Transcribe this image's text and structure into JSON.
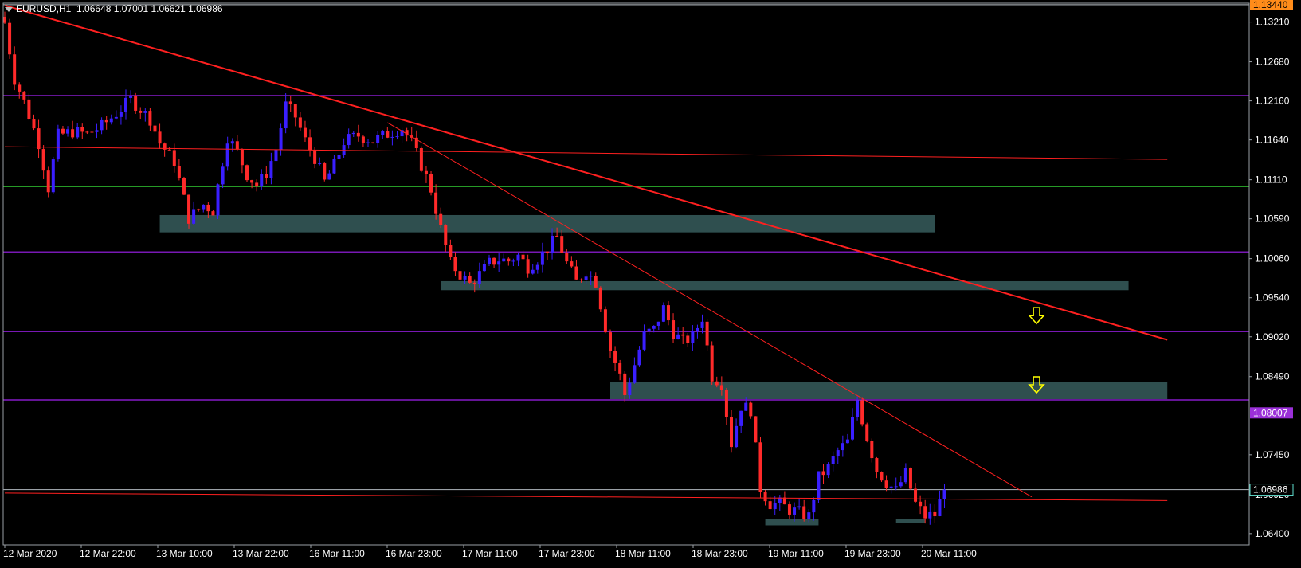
{
  "header": {
    "symbol": "EURUSD,H1",
    "ohlc": "1.06648 1.07001 1.06621 1.06986"
  },
  "colors": {
    "background": "#000000",
    "frame": "#9aa0a6",
    "bull_candle": "#3a1fff",
    "bear_candle": "#ff2a2a",
    "zone_fill": "#2f4f4f",
    "horizontal_purple": "#a020f0",
    "horizontal_green": "#32cd32",
    "trend_red": "#ff2020",
    "arrow_yellow": "#ffff00",
    "label_orange": "#ff8c1a",
    "label_violet": "#9b30d9",
    "label_teal": "#5fe0d0",
    "axis_text": "#ffffff"
  },
  "chart_data": {
    "type": "candlestick",
    "symbol": "EURUSD",
    "timeframe": "H1",
    "ylim": [
      1.0625,
      1.1346
    ],
    "y_ticks": [
      "1.13210",
      "1.12680",
      "1.12160",
      "1.11640",
      "1.11110",
      "1.10590",
      "1.10060",
      "1.09540",
      "1.09020",
      "1.08490",
      "1.07450",
      "1.06920",
      "1.06400"
    ],
    "x_tick_labels": [
      "12 Mar 2020",
      "12 Mar 22:00",
      "13 Mar 10:00",
      "13 Mar 22:00",
      "16 Mar 11:00",
      "16 Mar 23:00",
      "17 Mar 11:00",
      "17 Mar 23:00",
      "18 Mar 11:00",
      "18 Mar 23:00",
      "19 Mar 11:00",
      "19 Mar 23:00",
      "20 Mar 11:00"
    ],
    "price_labels": [
      {
        "text": "1.13440",
        "price": 1.1344,
        "style": "orange"
      },
      {
        "text": "1.08007",
        "price": 1.08007,
        "style": "violet"
      },
      {
        "text": "1.06986",
        "price": 1.06986,
        "style": "teal"
      }
    ],
    "horizontal_levels": [
      {
        "price": 1.1223,
        "color": "purple"
      },
      {
        "price": 1.1102,
        "color": "green"
      },
      {
        "price": 1.1015,
        "color": "purple"
      },
      {
        "price": 1.0909,
        "color": "purple"
      },
      {
        "price": 1.0818,
        "color": "purple"
      },
      {
        "price": 1.1344,
        "color": "grey"
      },
      {
        "price": 1.06986,
        "color": "grey"
      }
    ],
    "zones": [
      {
        "bar_from": 32,
        "bar_to": 192,
        "price_top": 1.1064,
        "price_bottom": 1.1041
      },
      {
        "bar_from": 90,
        "bar_to": 232,
        "price_top": 1.0976,
        "price_bottom": 1.0964
      },
      {
        "bar_from": 125,
        "bar_to": 240,
        "price_top": 1.0842,
        "price_bottom": 1.0819
      },
      {
        "bar_from": 157,
        "bar_to": 168,
        "price_top": 1.0659,
        "price_bottom": 1.0651
      },
      {
        "bar_from": 184,
        "bar_to": 190,
        "price_top": 1.066,
        "price_bottom": 1.0654
      }
    ],
    "trendlines": [
      {
        "from": {
          "bar": 0,
          "price": 1.1343
        },
        "to": {
          "bar": 240,
          "price": 1.0898
        },
        "width": 2
      },
      {
        "from": {
          "bar": 79,
          "price": 1.1187
        },
        "to": {
          "bar": 212,
          "price": 1.0689
        },
        "width": 1
      },
      {
        "from": {
          "bar": 0,
          "price": 1.1155
        },
        "to": {
          "bar": 240,
          "price": 1.1138
        },
        "width": 1
      },
      {
        "from": {
          "bar": 0,
          "price": 1.0694
        },
        "to": {
          "bar": 240,
          "price": 1.0684
        },
        "width": 1
      }
    ],
    "arrows": [
      {
        "bar": 213,
        "price": 1.0928
      },
      {
        "bar": 213,
        "price": 1.0836
      }
    ],
    "anchors": [
      {
        "bar": 0,
        "price": 1.132
      },
      {
        "bar": 2,
        "price": 1.1245
      },
      {
        "bar": 4,
        "price": 1.1215
      },
      {
        "bar": 7,
        "price": 1.116
      },
      {
        "bar": 9,
        "price": 1.11
      },
      {
        "bar": 11,
        "price": 1.117
      },
      {
        "bar": 14,
        "price": 1.1175
      },
      {
        "bar": 17,
        "price": 1.1172
      },
      {
        "bar": 20,
        "price": 1.1182
      },
      {
        "bar": 24,
        "price": 1.1205
      },
      {
        "bar": 26,
        "price": 1.1218
      },
      {
        "bar": 30,
        "price": 1.1192
      },
      {
        "bar": 32,
        "price": 1.116
      },
      {
        "bar": 35,
        "price": 1.1135
      },
      {
        "bar": 38,
        "price": 1.106
      },
      {
        "bar": 41,
        "price": 1.1078
      },
      {
        "bar": 43,
        "price": 1.107
      },
      {
        "bar": 46,
        "price": 1.1168
      },
      {
        "bar": 48,
        "price": 1.1148
      },
      {
        "bar": 50,
        "price": 1.1118
      },
      {
        "bar": 52,
        "price": 1.1103
      },
      {
        "bar": 54,
        "price": 1.112
      },
      {
        "bar": 56,
        "price": 1.1152
      },
      {
        "bar": 58,
        "price": 1.121
      },
      {
        "bar": 60,
        "price": 1.1195
      },
      {
        "bar": 62,
        "price": 1.1163
      },
      {
        "bar": 64,
        "price": 1.114
      },
      {
        "bar": 66,
        "price": 1.1108
      },
      {
        "bar": 68,
        "price": 1.113
      },
      {
        "bar": 70,
        "price": 1.1162
      },
      {
        "bar": 73,
        "price": 1.117
      },
      {
        "bar": 76,
        "price": 1.1163
      },
      {
        "bar": 79,
        "price": 1.1172
      },
      {
        "bar": 82,
        "price": 1.118
      },
      {
        "bar": 84,
        "price": 1.116
      },
      {
        "bar": 86,
        "price": 1.113
      },
      {
        "bar": 88,
        "price": 1.1098
      },
      {
        "bar": 90,
        "price": 1.1045
      },
      {
        "bar": 92,
        "price": 1.1
      },
      {
        "bar": 94,
        "price": 1.0985
      },
      {
        "bar": 96,
        "price": 1.0972
      },
      {
        "bar": 98,
        "price": 1.0985
      },
      {
        "bar": 100,
        "price": 1.1
      },
      {
        "bar": 102,
        "price": 1.1005
      },
      {
        "bar": 104,
        "price": 1.1003
      },
      {
        "bar": 106,
        "price": 1.101
      },
      {
        "bar": 108,
        "price": 1.0995
      },
      {
        "bar": 110,
        "price": 1.1005
      },
      {
        "bar": 112,
        "price": 1.102
      },
      {
        "bar": 114,
        "price": 1.1035
      },
      {
        "bar": 116,
        "price": 1.1
      },
      {
        "bar": 118,
        "price": 1.0975
      },
      {
        "bar": 120,
        "price": 1.099
      },
      {
        "bar": 122,
        "price": 1.0975
      },
      {
        "bar": 123,
        "price": 1.0945
      },
      {
        "bar": 125,
        "price": 1.0885
      },
      {
        "bar": 127,
        "price": 1.085
      },
      {
        "bar": 128,
        "price": 1.0825
      },
      {
        "bar": 130,
        "price": 1.0865
      },
      {
        "bar": 132,
        "price": 1.0905
      },
      {
        "bar": 134,
        "price": 1.0912
      },
      {
        "bar": 136,
        "price": 1.094
      },
      {
        "bar": 138,
        "price": 1.0908
      },
      {
        "bar": 140,
        "price": 1.0895
      },
      {
        "bar": 142,
        "price": 1.0902
      },
      {
        "bar": 144,
        "price": 1.0928
      },
      {
        "bar": 146,
        "price": 1.085
      },
      {
        "bar": 148,
        "price": 1.084
      },
      {
        "bar": 150,
        "price": 1.076
      },
      {
        "bar": 152,
        "price": 1.081
      },
      {
        "bar": 154,
        "price": 1.0805
      },
      {
        "bar": 156,
        "price": 1.07
      },
      {
        "bar": 158,
        "price": 1.068
      },
      {
        "bar": 160,
        "price": 1.068
      },
      {
        "bar": 162,
        "price": 1.0672
      },
      {
        "bar": 164,
        "price": 1.0668
      },
      {
        "bar": 166,
        "price": 1.0663
      },
      {
        "bar": 168,
        "price": 1.0715
      },
      {
        "bar": 170,
        "price": 1.0728
      },
      {
        "bar": 172,
        "price": 1.075
      },
      {
        "bar": 174,
        "price": 1.0762
      },
      {
        "bar": 176,
        "price": 1.0818
      },
      {
        "bar": 177,
        "price": 1.0792
      },
      {
        "bar": 178,
        "price": 1.0768
      },
      {
        "bar": 180,
        "price": 1.0725
      },
      {
        "bar": 182,
        "price": 1.0708
      },
      {
        "bar": 184,
        "price": 1.0697
      },
      {
        "bar": 186,
        "price": 1.072
      },
      {
        "bar": 188,
        "price": 1.068
      },
      {
        "bar": 190,
        "price": 1.0663
      },
      {
        "bar": 192,
        "price": 1.0665
      },
      {
        "bar": 194,
        "price": 1.06986
      }
    ]
  }
}
